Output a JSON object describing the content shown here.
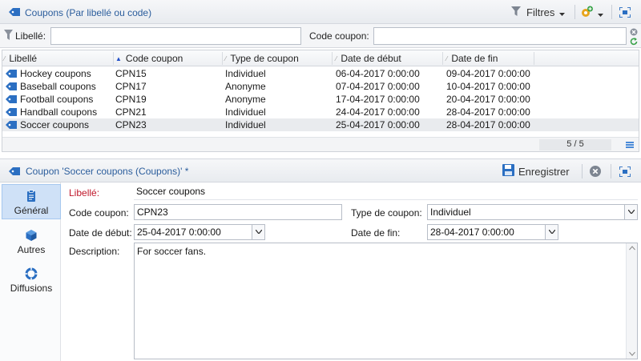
{
  "list_header": {
    "title": "Coupons (Par libellé ou code)",
    "filters_label": "Filtres"
  },
  "filter_row": {
    "libelle_label": "Libellé:",
    "libelle_value": "",
    "code_label": "Code coupon:",
    "code_value": ""
  },
  "grid": {
    "columns": [
      "Libellé",
      "Code coupon",
      "Type de coupon",
      "Date de début",
      "Date de fin"
    ],
    "sorted_column": "Code coupon",
    "rows": [
      [
        "Hockey coupons",
        "CPN15",
        "Individuel",
        "06-04-2017 0:00:00",
        "09-04-2017 0:00:00"
      ],
      [
        "Baseball coupons",
        "CPN17",
        "Anonyme",
        "07-04-2017 0:00:00",
        "10-04-2017 0:00:00"
      ],
      [
        "Football coupons",
        "CPN19",
        "Anonyme",
        "17-04-2017 0:00:00",
        "20-04-2017 0:00:00"
      ],
      [
        "Handball coupons",
        "CPN21",
        "Individuel",
        "24-04-2017 0:00:00",
        "28-04-2017 0:00:00"
      ],
      [
        "Soccer coupons",
        "CPN23",
        "Individuel",
        "25-04-2017 0:00:00",
        "28-04-2017 0:00:00"
      ]
    ],
    "selected_row": 4,
    "count": "5 / 5"
  },
  "detail_header": {
    "title": "Coupon 'Soccer coupons (Coupons)' *",
    "save_label": "Enregistrer"
  },
  "nav": {
    "items": [
      {
        "label": "Général",
        "icon": "clipboard-icon",
        "active": true
      },
      {
        "label": "Autres",
        "icon": "cube-icon",
        "active": false
      },
      {
        "label": "Diffusions",
        "icon": "broadcast-icon",
        "active": false
      }
    ]
  },
  "form": {
    "libelle_label": "Libellé:",
    "libelle_value": "Soccer coupons",
    "code_label": "Code coupon:",
    "code_value": "CPN23",
    "type_label": "Type de coupon:",
    "type_value": "Individuel",
    "debut_label": "Date de début:",
    "debut_value": "25-04-2017 0:00:00",
    "fin_label": "Date de fin:",
    "fin_value": "28-04-2017 0:00:00",
    "description_label": "Description:",
    "description_value": "For soccer fans."
  },
  "colors": {
    "accent": "#2b6fc2",
    "title_text": "#2b5d9c",
    "required_label": "#c0182b",
    "selected_row": "#e9ebee",
    "active_nav": "#cfe1f7"
  }
}
